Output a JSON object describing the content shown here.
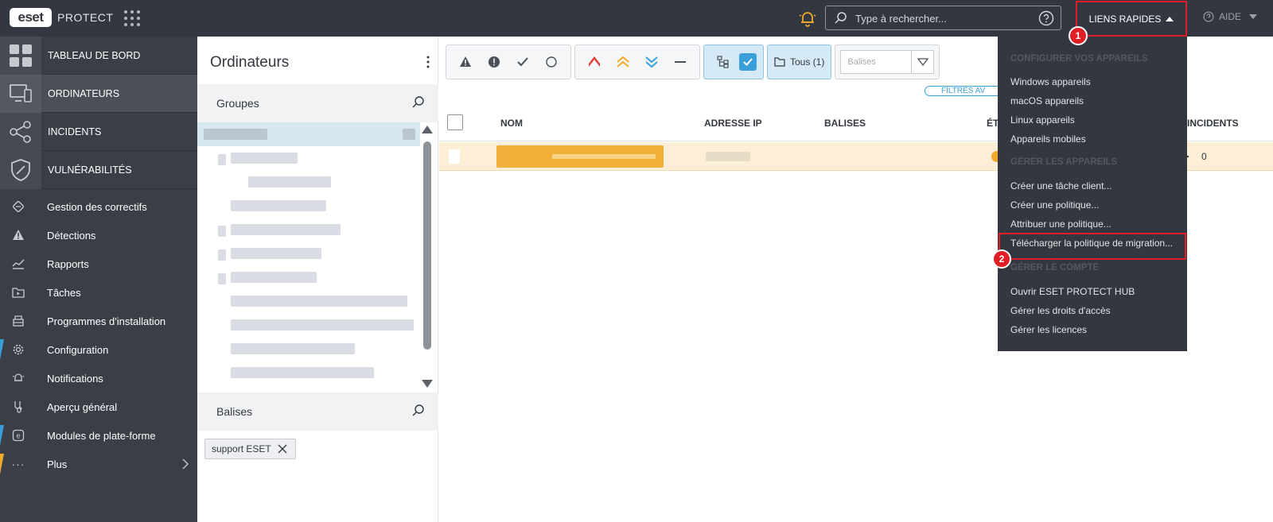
{
  "topbar": {
    "logo": "eset",
    "product": "PROTECT",
    "search_placeholder": "Type à rechercher...",
    "quick_links_label": "LIENS RAPIDES",
    "help_label": "AIDE"
  },
  "sidebar": {
    "main_items": [
      {
        "label": "TABLEAU DE BORD",
        "icon": "dashboard-icon"
      },
      {
        "label": "ORDINATEURS",
        "icon": "computers-icon"
      },
      {
        "label": "INCIDENTS",
        "icon": "incidents-icon"
      },
      {
        "label": "VULNÉRABILITÉS",
        "icon": "shield-icon"
      }
    ],
    "sub_items": [
      {
        "label": "Gestion des correctifs",
        "icon": "patch-icon"
      },
      {
        "label": "Détections",
        "icon": "warning-icon"
      },
      {
        "label": "Rapports",
        "icon": "reports-icon"
      },
      {
        "label": "Tâches",
        "icon": "tasks-icon"
      },
      {
        "label": "Programmes d'installation",
        "icon": "installer-icon"
      },
      {
        "label": "Configuration",
        "icon": "gear-icon"
      },
      {
        "label": "Notifications",
        "icon": "notifications-icon"
      },
      {
        "label": "Aperçu général",
        "icon": "overview-icon"
      },
      {
        "label": "Modules de plate-forme",
        "icon": "modules-icon"
      },
      {
        "label": "Plus",
        "icon": "more-icon"
      }
    ]
  },
  "panel": {
    "title": "Ordinateurs",
    "groups_label": "Groupes",
    "tags_label": "Balises",
    "tag_chip": "support ESET"
  },
  "main": {
    "all_filter_label": "Tous (1)",
    "tags_placeholder": "Balises",
    "filters_label": "FILTRES AV",
    "columns": {
      "name": "NOM",
      "ip": "ADRESSE IP",
      "tags": "BALISES",
      "status": "ÉT",
      "incidents": "INCIDENTS"
    },
    "row_incidents": "0"
  },
  "quick_links": {
    "sections": [
      {
        "title": "CONFIGURER VOS APPAREILS",
        "items": [
          "Windows appareils",
          "macOS appareils",
          "Linux appareils",
          "Appareils mobiles"
        ]
      },
      {
        "title": "GÉRER LES APPAREILS",
        "items": [
          "Créer une tâche client...",
          "Créer une politique...",
          "Attribuer une politique...",
          "Télécharger la politique de migration..."
        ]
      },
      {
        "title": "GÉRER LE COMPTE",
        "items": [
          "Ouvrir ESET PROTECT HUB",
          "Gérer les droits d'accès",
          "Gérer les licences"
        ]
      }
    ]
  },
  "annotations": {
    "badge1": "1",
    "badge2": "2"
  },
  "colors": {
    "accent_blue": "#3a9fd9",
    "highlight_red": "#e01e25",
    "warning_orange": "#f0a92a",
    "dark_bg": "#33373f"
  }
}
